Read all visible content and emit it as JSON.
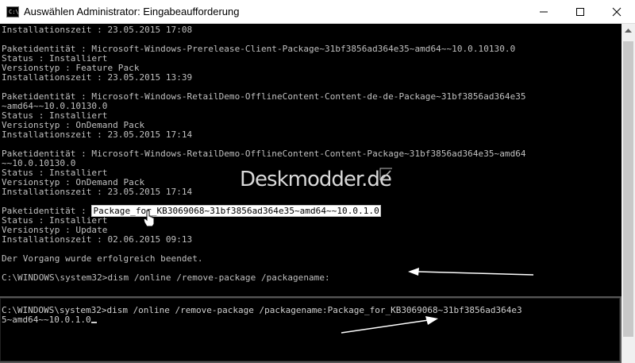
{
  "window": {
    "title": "Auswählen Administrator: Eingabeaufforderung",
    "icon_label": "C:\\",
    "buttons": {
      "minimize": "minimize-icon",
      "maximize": "maximize-icon",
      "close": "close-icon"
    }
  },
  "console": {
    "lines": [
      "Installationszeit : 23.05.2015 17:08",
      "",
      "Paketidentität : Microsoft-Windows-Prerelease-Client-Package~31bf3856ad364e35~amd64~~10.0.10130.0",
      "Status : Installiert",
      "Versionstyp : Feature Pack",
      "Installationszeit : 23.05.2015 13:39",
      "",
      "Paketidentität : Microsoft-Windows-RetailDemo-OfflineContent-Content-de-de-Package~31bf3856ad364e35",
      "~amd64~~10.0.10130.0",
      "Status : Installiert",
      "Versionstyp : OnDemand Pack",
      "Installationszeit : 23.05.2015 17:14",
      "",
      "Paketidentität : Microsoft-Windows-RetailDemo-OfflineContent-Content-Package~31bf3856ad364e35~amd64",
      "~~10.0.10130.0",
      "Status : Installiert",
      "Versionstyp : OnDemand Pack",
      "Installationszeit : 23.05.2015 17:14",
      "",
      "Paketidentität : ",
      "Status : Installiert",
      "Versionstyp : Update",
      "Installationszeit : 02.06.2015 09:13",
      "",
      "Der Vorgang wurde erfolgreich beendet.",
      "",
      "C:\\WINDOWS\\system32>dism /online /remove-package /packagename:"
    ],
    "highlighted_package": "Package_for_KB3069068~31bf3856ad364e35~amd64~~10.0.1.0"
  },
  "watermark": "Deskmodder.de",
  "inset": {
    "line1": "C:\\WINDOWS\\system32>dism /online /remove-package /packagename:Package_for_KB3069068~31bf3856ad364e3",
    "line2": "5~amd64~~10.0.1.0"
  },
  "colors": {
    "console_bg": "#000000",
    "console_fg": "#c0c0c0",
    "highlight_bg": "#ffffff",
    "arrow": "#ffffff"
  }
}
